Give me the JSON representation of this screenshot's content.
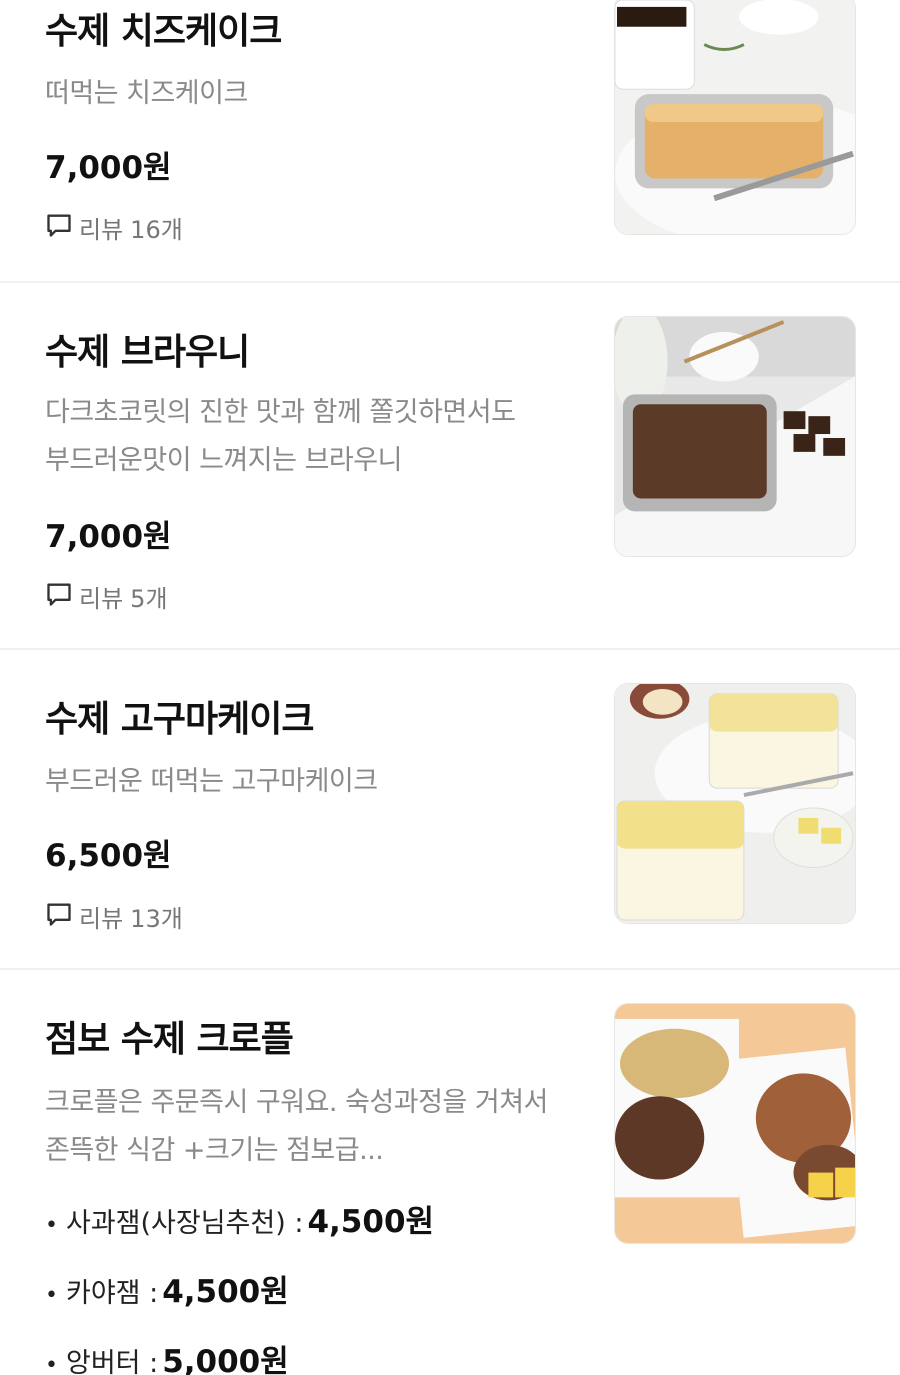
{
  "menu": [
    {
      "name": "수제 치즈케이크",
      "description": "떠먹는 치즈케이크",
      "price": "7,000원",
      "review_label": "리뷰",
      "review_count": "16개",
      "image_icon": "cheesecake-photo"
    },
    {
      "name": "수제 브라우니",
      "description_lines": [
        "다크초코릿의 진한 맛과 함께 쫄깃하면서도",
        "부드러운맛이 느껴지는 브라우니"
      ],
      "price": "7,000원",
      "review_label": "리뷰",
      "review_count": "5개",
      "image_icon": "brownie-photo"
    },
    {
      "name": "수제 고구마케이크",
      "description": "부드러운 떠먹는 고구마케이크",
      "price": "6,500원",
      "review_label": "리뷰",
      "review_count": "13개",
      "image_icon": "sweet-potato-cake-photo"
    },
    {
      "name": "점보 수제  크로플",
      "description_lines": [
        "크로플은 주문즉시 구워요. 숙성과정을 거쳐서",
        "존뜩한 식감 +크기는 점보급..."
      ],
      "options": [
        {
          "label": "사과잼(사장님추천) :",
          "price": "4,500원"
        },
        {
          "label": "카야잼 :",
          "price": "4,500원"
        },
        {
          "label": "앙버터 :",
          "price": "5,000원"
        }
      ],
      "image_icon": "croffle-photo"
    }
  ],
  "icons": {
    "review": "chat-bubble-icon",
    "bullet": "•"
  },
  "colors": {
    "text_primary": "#111111",
    "text_secondary": "#8a8a8a",
    "divider": "#f0f0f0"
  }
}
